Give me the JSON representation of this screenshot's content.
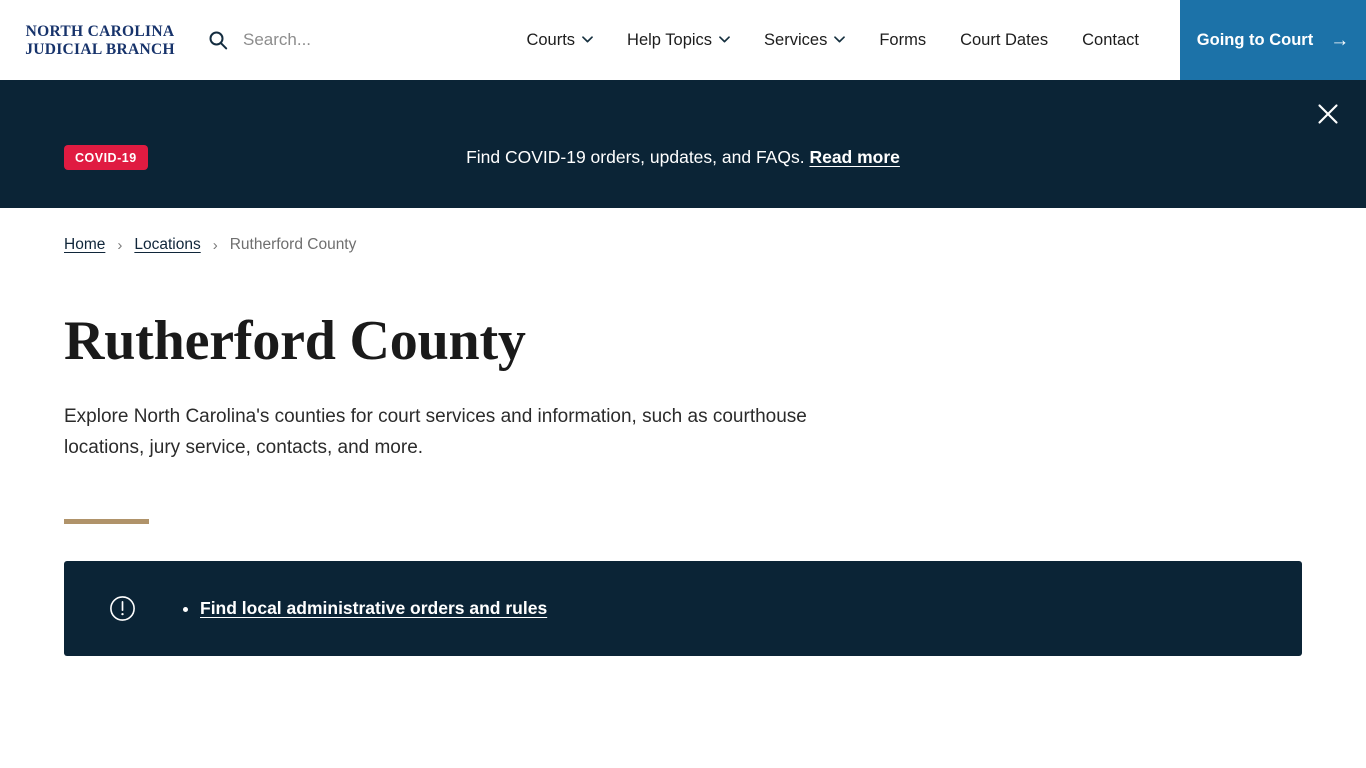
{
  "header": {
    "logo": {
      "line1": "NORTH CAROLINA",
      "line2": "JUDICIAL BRANCH",
      "icon": "nc-judicial-branch-logo"
    },
    "search": {
      "icon": "search-icon",
      "placeholder": "Search...",
      "value": ""
    },
    "nav": [
      {
        "label": "Courts",
        "has_dropdown": true
      },
      {
        "label": "Help Topics",
        "has_dropdown": true
      },
      {
        "label": "Services",
        "has_dropdown": true
      },
      {
        "label": "Forms",
        "has_dropdown": false
      },
      {
        "label": "Court Dates",
        "has_dropdown": false
      },
      {
        "label": "Contact",
        "has_dropdown": false
      }
    ],
    "cta": {
      "label": "Going to Court",
      "icon": "arrow-right-icon",
      "background": "#1c72a8"
    }
  },
  "banner": {
    "badge": "COVID-19",
    "badge_color": "#e01b41",
    "background": "#0b2436",
    "text": "Find COVID-19 orders, updates, and FAQs.",
    "link_label": "Read more",
    "close_icon": "close-icon"
  },
  "breadcrumb": {
    "items": [
      {
        "label": "Home",
        "current": false
      },
      {
        "label": "Locations",
        "current": false
      },
      {
        "label": "Rutherford County",
        "current": true
      }
    ],
    "separator": "›"
  },
  "main": {
    "title": "Rutherford County",
    "description": "Explore North Carolina's counties for court services and information, such as courthouse locations, jury service, contacts, and more.",
    "divider_color": "#b0936a",
    "alert": {
      "icon": "alert-circle-icon",
      "background": "#0b2436",
      "links": [
        {
          "label": "Find local administrative orders and rules"
        }
      ]
    }
  }
}
